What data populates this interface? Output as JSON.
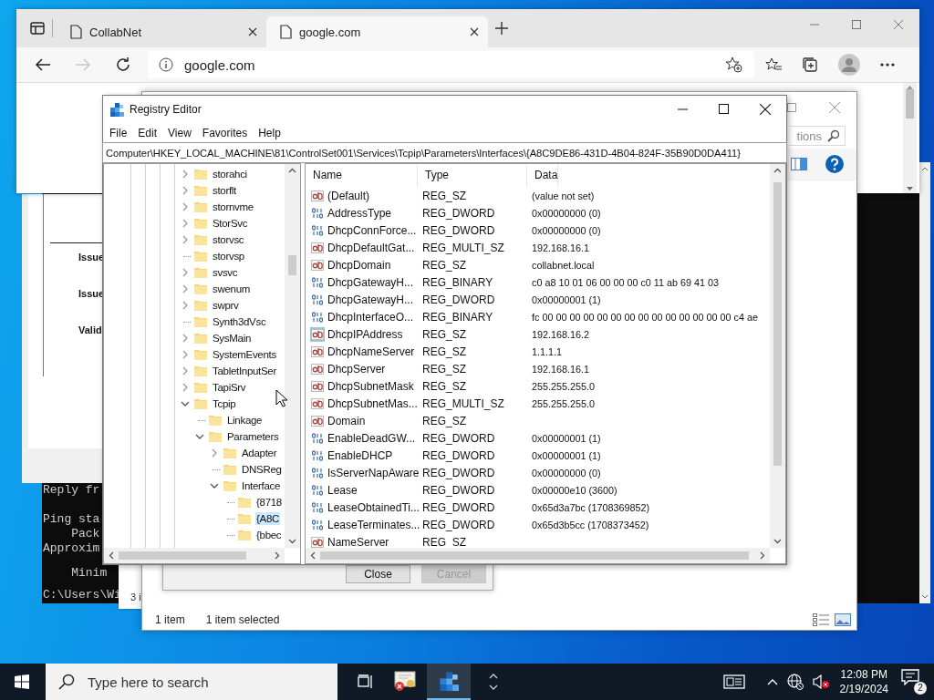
{
  "command_prompt": {
    "lines": [
      {
        "text": "Reply fr",
        "indent": false
      },
      {
        "text": "Ping sta",
        "indent": false
      },
      {
        "text": "Pack",
        "indent": true
      },
      {
        "text": "Approxim",
        "indent": false
      },
      {
        "text": "Minim",
        "indent": true
      },
      {
        "text": "C:\\Users\\Wi",
        "indent": false
      }
    ]
  },
  "certificate_window": {
    "labels": [
      "Issue",
      "Issue",
      "Valid"
    ]
  },
  "small_window": {
    "status": "3 i"
  },
  "browser": {
    "tabs": [
      {
        "label": "CollabNet",
        "selected": false
      },
      {
        "label": "google.com",
        "selected": true
      }
    ],
    "address": "google.com"
  },
  "explorer": {
    "search": {
      "placeholder": "tions"
    },
    "status_bar": [
      "1 item",
      "1 item selected"
    ]
  },
  "dialog": {
    "buttons": [
      {
        "label": "Close",
        "disabled": false
      },
      {
        "label": "Cancel",
        "disabled": true
      }
    ]
  },
  "registry_editor": {
    "title": "Registry Editor",
    "menu": [
      "File",
      "Edit",
      "View",
      "Favorites",
      "Help"
    ],
    "address": "Computer\\HKEY_LOCAL_MACHINE\\81\\ControlSet001\\Services\\Tcpip\\Parameters\\Interfaces\\{A8C9DE86-431D-4B04-824F-35B90D0DA411}",
    "tree": [
      {
        "label": "storahci",
        "kind": "branch",
        "expanded": false,
        "selected": false
      },
      {
        "label": "storflt",
        "kind": "branch",
        "expanded": false,
        "selected": false
      },
      {
        "label": "stornvme",
        "kind": "branch",
        "expanded": false,
        "selected": false
      },
      {
        "label": "StorSvc",
        "kind": "branch",
        "expanded": false,
        "selected": false
      },
      {
        "label": "storvsc",
        "kind": "branch",
        "expanded": false,
        "selected": false
      },
      {
        "label": "storvsp",
        "kind": "leaf",
        "expanded": false,
        "selected": false
      },
      {
        "label": "svsvc",
        "kind": "branch",
        "expanded": false,
        "selected": false
      },
      {
        "label": "swenum",
        "kind": "branch",
        "expanded": false,
        "selected": false
      },
      {
        "label": "swprv",
        "kind": "branch",
        "expanded": false,
        "selected": false
      },
      {
        "label": "Synth3dVsc",
        "kind": "leaf",
        "expanded": false,
        "selected": false
      },
      {
        "label": "SysMain",
        "kind": "branch",
        "expanded": false,
        "selected": false
      },
      {
        "label": "SystemEvents",
        "kind": "branch",
        "expanded": false,
        "selected": false
      },
      {
        "label": "TabletInputSer",
        "kind": "branch",
        "expanded": false,
        "selected": false
      },
      {
        "label": "TapiSrv",
        "kind": "branch",
        "expanded": false,
        "selected": false
      },
      {
        "label": "Tcpip",
        "kind": "branch",
        "expanded": true,
        "selected": false,
        "children": [
          {
            "label": "Linkage",
            "kind": "leaf",
            "expanded": false,
            "selected": false
          },
          {
            "label": "Parameters",
            "kind": "branch",
            "expanded": true,
            "selected": false,
            "children": [
              {
                "label": "Adapter",
                "kind": "branch",
                "expanded": false,
                "selected": false
              },
              {
                "label": "DNSReg",
                "kind": "leaf",
                "expanded": false,
                "selected": false
              },
              {
                "label": "Interface",
                "kind": "branch",
                "expanded": true,
                "selected": false,
                "children": [
                  {
                    "label": "{8718",
                    "kind": "leaf",
                    "expanded": false,
                    "selected": false
                  },
                  {
                    "label": "{A8C",
                    "kind": "leaf",
                    "expanded": false,
                    "selected": true
                  },
                  {
                    "label": "{bbec",
                    "kind": "leaf",
                    "expanded": false,
                    "selected": false
                  }
                ]
              }
            ]
          }
        ]
      }
    ],
    "columns": [
      "Name",
      "Type",
      "Data"
    ],
    "values": [
      {
        "kind": "string",
        "name": "(Default)",
        "type": "REG_SZ",
        "data": "(value not set)",
        "selected": false
      },
      {
        "kind": "binary",
        "name": "AddressType",
        "type": "REG_DWORD",
        "data": "0x00000000 (0)",
        "selected": false
      },
      {
        "kind": "binary",
        "name": "DhcpConnForce...",
        "type": "REG_DWORD",
        "data": "0x00000000 (0)",
        "selected": false
      },
      {
        "kind": "string",
        "name": "DhcpDefaultGat...",
        "type": "REG_MULTI_SZ",
        "data": "192.168.16.1",
        "selected": false
      },
      {
        "kind": "string",
        "name": "DhcpDomain",
        "type": "REG_SZ",
        "data": "collabnet.local",
        "selected": false
      },
      {
        "kind": "binary",
        "name": "DhcpGatewayH...",
        "type": "REG_BINARY",
        "data": "c0 a8 10 01 06 00 00 00 c0 11 ab 69 41 03",
        "selected": false
      },
      {
        "kind": "binary",
        "name": "DhcpGatewayH...",
        "type": "REG_DWORD",
        "data": "0x00000001 (1)",
        "selected": false
      },
      {
        "kind": "binary",
        "name": "DhcpInterfaceO...",
        "type": "REG_BINARY",
        "data": "fc 00 00 00 00 00 00 00 00 00 00 00 00 00 00 c4 ae",
        "selected": false
      },
      {
        "kind": "string",
        "name": "DhcpIPAddress",
        "type": "REG_SZ",
        "data": "192.168.16.2",
        "selected": true
      },
      {
        "kind": "string",
        "name": "DhcpNameServer",
        "type": "REG_SZ",
        "data": "1.1.1.1",
        "selected": false
      },
      {
        "kind": "string",
        "name": "DhcpServer",
        "type": "REG_SZ",
        "data": "192.168.16.1",
        "selected": false
      },
      {
        "kind": "string",
        "name": "DhcpSubnetMask",
        "type": "REG_SZ",
        "data": "255.255.255.0",
        "selected": false
      },
      {
        "kind": "string",
        "name": "DhcpSubnetMas...",
        "type": "REG_MULTI_SZ",
        "data": "255.255.255.0",
        "selected": false
      },
      {
        "kind": "string",
        "name": "Domain",
        "type": "REG_SZ",
        "selected": false
      },
      {
        "kind": "binary",
        "name": "EnableDeadGW...",
        "type": "REG_DWORD",
        "data": "0x00000001 (1)",
        "selected": false
      },
      {
        "kind": "binary",
        "name": "EnableDHCP",
        "type": "REG_DWORD",
        "data": "0x00000001 (1)",
        "selected": false
      },
      {
        "kind": "binary",
        "name": "IsServerNapAware",
        "type": "REG_DWORD",
        "data": "0x00000000 (0)",
        "selected": false
      },
      {
        "kind": "binary",
        "name": "Lease",
        "type": "REG_DWORD",
        "data": "0x00000e10 (3600)",
        "selected": false
      },
      {
        "kind": "binary",
        "name": "LeaseObtainedTi...",
        "type": "REG_DWORD",
        "data": "0x65d3a7bc (1708369852)",
        "selected": false
      },
      {
        "kind": "binary",
        "name": "LeaseTerminates...",
        "type": "REG_DWORD",
        "data": "0x65d3b5cc (1708373452)",
        "selected": false
      },
      {
        "kind": "string",
        "name": "NameServer",
        "type": "REG_SZ",
        "selected": false
      }
    ]
  },
  "taskbar": {
    "search": {
      "placeholder": "Type here to search"
    },
    "apps": [
      {
        "kind": "certificate",
        "active": false
      },
      {
        "kind": "registry",
        "active": true
      }
    ],
    "time": "12:08 PM",
    "date": "2/19/2024",
    "notifications": "2"
  }
}
